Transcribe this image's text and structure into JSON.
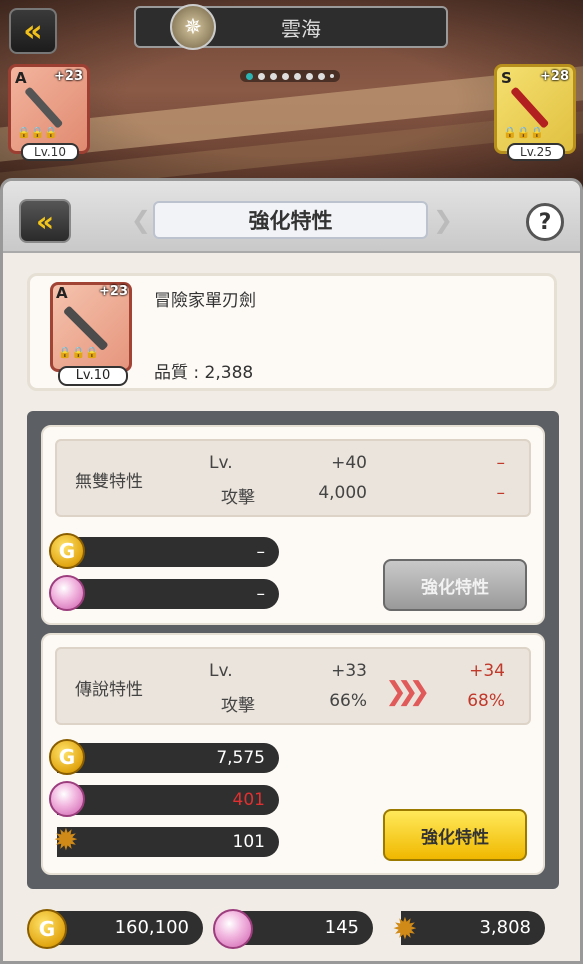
{
  "top": {
    "title": "雲海",
    "page_dots": 7,
    "left_weapon": {
      "grade": "A",
      "plus": "+23",
      "lv": "Lv.10"
    },
    "right_weapon": {
      "grade": "S",
      "plus": "+28",
      "lv": "Lv.25"
    }
  },
  "panel": {
    "title": "強化特性",
    "help": "?"
  },
  "item": {
    "grade": "A",
    "plus": "+23",
    "lv": "Lv.10",
    "name": "冒險家單刃劍",
    "quality": "品質 : 2,388"
  },
  "trait1": {
    "name": "無雙特性",
    "lv_label": "Lv.",
    "atk_label": "攻擊",
    "lv_value": "+40",
    "atk_value": "4,000",
    "next_lv": "–",
    "next_atk": "–",
    "gold_cost": "–",
    "orb_cost": "–",
    "button": "強化特性"
  },
  "trait2": {
    "name": "傳說特性",
    "lv_label": "Lv.",
    "atk_label": "攻擊",
    "lv_value": "+33",
    "atk_value": "66%",
    "next_lv": "+34",
    "next_atk": "68%",
    "gold_cost": "7,575",
    "orb_cost": "401",
    "medal_cost": "101",
    "button": "強化特性"
  },
  "wallet": {
    "gold": "160,100",
    "orb": "145",
    "medal": "3,808"
  },
  "icons": [
    "back-icon",
    "help-icon",
    "gold-coin-icon",
    "orb-icon",
    "medal-icon",
    "arrows-icon",
    "lock-icon"
  ],
  "colors": {
    "accent_yellow": "#f0b800",
    "increase_red": "#c0392b",
    "dark_bar": "#2f2f2f"
  }
}
